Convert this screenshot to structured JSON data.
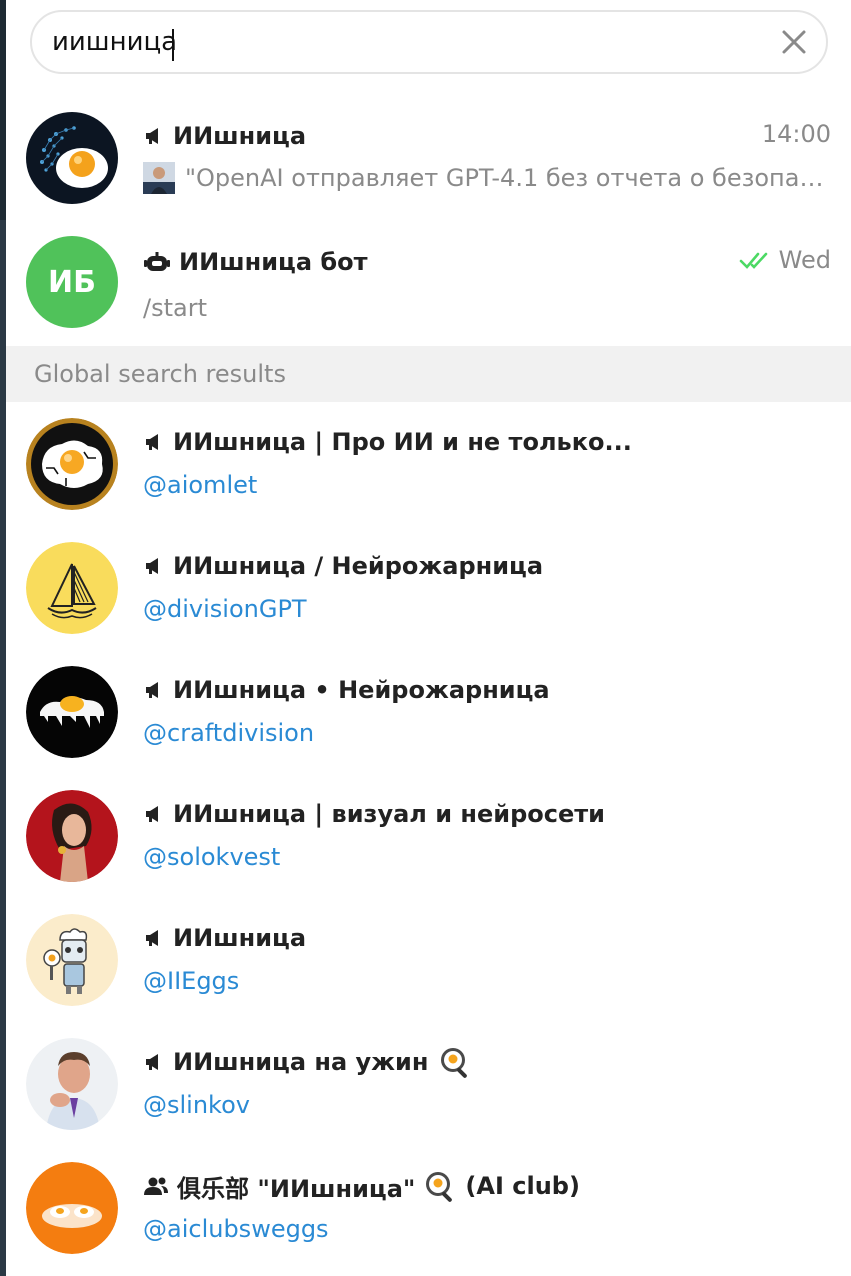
{
  "search": {
    "value": "иишница",
    "placeholder": "Search"
  },
  "chats": [
    {
      "title": "ИИшница",
      "time": "14:00",
      "preview": "\"OpenAI отправляет GPT-4.1 без отчета о безопасности\"",
      "type": "channel"
    },
    {
      "title": "ИИшница бот",
      "initials": "ИБ",
      "time": "Wed",
      "preview": "/start",
      "type": "bot",
      "status": "read",
      "accent": "#4cd964"
    }
  ],
  "global_header": "Global search results",
  "global_results": [
    {
      "title": "ИИшница | Про ИИ и не только...",
      "handle": "@aiomlet",
      "type": "channel"
    },
    {
      "title": "ИИшница / Нейрожарница",
      "handle": "@divisionGPT",
      "type": "channel"
    },
    {
      "title": "ИИшница • Нейрожарница",
      "handle": "@craftdivision",
      "type": "channel"
    },
    {
      "title": "ИИшница | визуал и нейросети",
      "handle": "@solokvest",
      "type": "channel"
    },
    {
      "title": "ИИшница",
      "handle": "@IIEggs",
      "type": "channel"
    },
    {
      "title": "ИИшница на ужин",
      "handle": "@slinkov",
      "type": "channel",
      "emoji": "frying-pan-egg"
    },
    {
      "title_a": "俱乐部 \"ИИшница\"",
      "title_b": "(AI club)",
      "handle": "@aiclubsweggs",
      "type": "group",
      "emoji": "frying-pan-egg"
    }
  ],
  "colors": {
    "link": "#2a8ad4",
    "muted": "#8a8a8a",
    "read_check": "#4cd964"
  }
}
